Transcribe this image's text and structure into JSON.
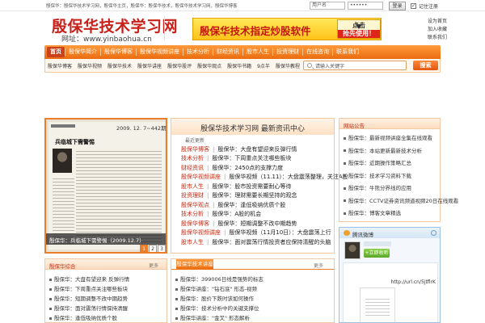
{
  "topbar": {
    "text": "殷保华：殷保华技术学习网，殷保华主页，殷保华：殷保华技术，殷保华技术学习网，殷保华博客",
    "username": "用户名",
    "password": "••••••",
    "login_label": "登录",
    "remember_label": "记住",
    "register_label": "注册"
  },
  "header": {
    "logo_title": "殷保华技术学习网",
    "logo_url": "网址：www.yinbaohua.cn",
    "banner_text": "殷保华技术指定炒股软件",
    "banner_badge_top": "点击",
    "banner_badge_bottom": "抢先使用！",
    "links": [
      "设为首页",
      "加入收藏",
      "联系我们"
    ]
  },
  "nav": {
    "items": [
      "首页",
      "殷保华简介",
      "殷保华博客",
      "殷保华视频讲座",
      "技术分析",
      "财经资讯",
      "股市人生",
      "投资理财",
      "在线咨询",
      "联系我们"
    ],
    "active_index": 0
  },
  "subnav": {
    "items": [
      "殷保华博客",
      "殷保华视频",
      "殷保华技术",
      "殷保华讲座",
      "殷保华股评",
      "殷保华观点",
      "殷保华书籍",
      "9点半",
      "殷保华教程"
    ]
  },
  "search": {
    "placeholder": "请输入关键字",
    "button_label": "搜索"
  },
  "magazine": {
    "date": "2009. 12. 7~442期",
    "headline": "兵临城下需警惕",
    "caption": "殷保华：兵临城下需警惕（2009.12.7）",
    "pages": [
      "1",
      "2",
      "3"
    ],
    "active_page": 0
  },
  "news": {
    "title": "殷保华技术学习网 最新资讯中心",
    "subtitle": "最近更新",
    "rows": [
      {
        "cat": "殷保华博客",
        "text": "殷保华：大盘有望迎来反弹行情"
      },
      {
        "cat": "技术分析",
        "text": "殷保华：下周重点关注哪些板块"
      },
      {
        "cat": "财经资讯",
        "text": "殷保华：2450点的支撑力度"
      },
      {
        "cat": "殷保华视频讲座",
        "text": "殷保华视频（11.11）：大盘震荡整理，关注A股"
      },
      {
        "cat": "股市人生",
        "text": "殷保华：股市投资需要耐心等待"
      },
      {
        "cat": "投资理财",
        "text": "殷保华：理财需要长期坚持的观念"
      },
      {
        "cat": "殷保华观点",
        "text": "殷保华：逢低吸纳优质个股"
      },
      {
        "cat": "技术分析",
        "text": "殷保华：A股的机会"
      },
      {
        "cat": "殷保华博客",
        "text": "殷保华：短期调整不改中期趋势"
      },
      {
        "cat": "殷保华视频讲座",
        "text": "殷保华视频（11月10日）：大盘震荡上行"
      },
      {
        "cat": "股市人生",
        "text": "殷保华：面对震荡行情投资者应保持清醒的头脑"
      }
    ]
  },
  "notice": {
    "title": "网站公告",
    "items": [
      "殷保华：最新视频讲座全集在线观看",
      "殷保华：本站更新最新技术分析",
      "殷保华：近期操作策略汇总",
      "殷保华：技术学习资料下载",
      "殷保华：牛熊分界线的应用",
      "殷保华：CCTV证券资讯频道视频20日在线观看",
      "殷保华：博客文章精选"
    ]
  },
  "weibo": {
    "title": "腾讯微博",
    "follow_label": "+立即收听",
    "post_text": "http://url.cn/5jtflrK"
  },
  "zonghe": {
    "title": "殷保华综合",
    "more": "更多",
    "items": [
      "殷保华：大盘有望迎来 反弹行情",
      "殷保华：下周重点关注哪些板块",
      "殷保华：短期调整不改中期趋势",
      "殷保华：面对震荡行情保持清醒",
      "殷保华：逢低吸纳优质个股"
    ]
  },
  "tech": {
    "tab_label": "殷保华技术讲座",
    "more": "更多",
    "items": [
      "殷保华：399006日线是强势的标志",
      "殷保华讲座：\"钻石底\" 形态-视频",
      "殷保华：股价下跌时该如何操作",
      "殷保华：技术分析中的关键支撑位",
      "殷保华讲座：\"金叉\" 形态解析"
    ]
  }
}
